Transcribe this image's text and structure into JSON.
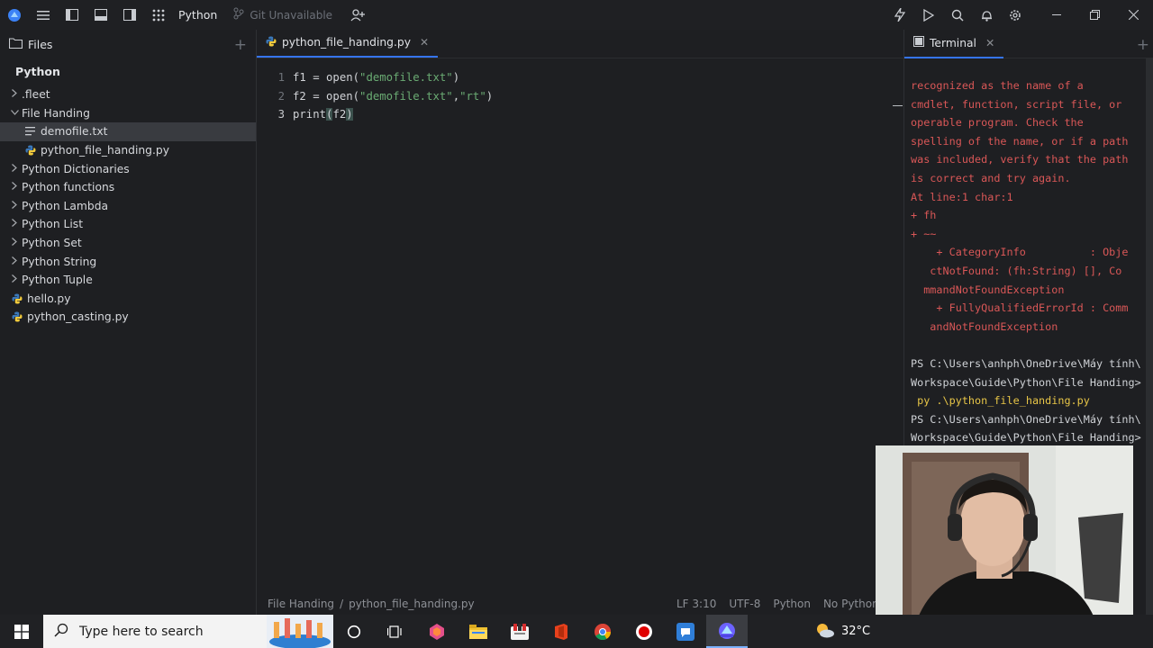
{
  "topbar": {
    "project": "Python",
    "git": "Git Unavailable"
  },
  "files_panel": {
    "tab_label": "Files",
    "root": "Python",
    "items": [
      {
        "label": ".fleet",
        "kind": "folder",
        "depth": 0,
        "expanded": false
      },
      {
        "label": "File Handing",
        "kind": "folder",
        "depth": 0,
        "expanded": true
      },
      {
        "label": "demofile.txt",
        "kind": "text-file",
        "depth": 1,
        "selected": true
      },
      {
        "label": "python_file_handing.py",
        "kind": "python-file",
        "depth": 1
      },
      {
        "label": "Python Dictionaries",
        "kind": "folder",
        "depth": 0,
        "expanded": false
      },
      {
        "label": "Python functions",
        "kind": "folder",
        "depth": 0,
        "expanded": false
      },
      {
        "label": "Python Lambda",
        "kind": "folder",
        "depth": 0,
        "expanded": false
      },
      {
        "label": "Python List",
        "kind": "folder",
        "depth": 0,
        "expanded": false
      },
      {
        "label": "Python Set",
        "kind": "folder",
        "depth": 0,
        "expanded": false
      },
      {
        "label": "Python String",
        "kind": "folder",
        "depth": 0,
        "expanded": false
      },
      {
        "label": "Python Tuple",
        "kind": "folder",
        "depth": 0,
        "expanded": false
      },
      {
        "label": "hello.py",
        "kind": "python-file",
        "depth": 0
      },
      {
        "label": "python_casting.py",
        "kind": "python-file",
        "depth": 0
      }
    ]
  },
  "editor": {
    "tab_label": "python_file_handing.py",
    "lines": [
      {
        "num": "1",
        "pre": "f1 = open(",
        "str": "\"demofile.txt\"",
        "post": ")"
      },
      {
        "num": "2",
        "pre": "f2 = open(",
        "str": "\"demofile.txt\"",
        "mid": ",",
        "str2": "\"rt\"",
        "post": ")"
      },
      {
        "num": "3",
        "pre": "print",
        "paren_open": "(",
        "arg": "f2",
        "paren_close": ")"
      }
    ]
  },
  "statusbar": {
    "crumb_1": "File Handing",
    "crumb_sep": "/",
    "crumb_2": "python_file_handing.py",
    "position": "LF 3:10",
    "encoding": "UTF-8",
    "language": "Python",
    "interpreter": "No Python S"
  },
  "terminal": {
    "tab_label": "Terminal",
    "lines": [
      {
        "text": "recognized as the name of a",
        "style": "err"
      },
      {
        "text": "cmdlet, function, script file, or",
        "style": "err"
      },
      {
        "text": "operable program. Check the",
        "style": "err"
      },
      {
        "text": "spelling of the name, or if a path",
        "style": "err"
      },
      {
        "text": "was included, verify that the path",
        "style": "err"
      },
      {
        "text": "is correct and try again.",
        "style": "err"
      },
      {
        "text": "At line:1 char:1",
        "style": "err"
      },
      {
        "text": "+ fh",
        "style": "err"
      },
      {
        "text": "+ ~~",
        "style": "err"
      },
      {
        "text": "    + CategoryInfo          : Obje",
        "style": "err"
      },
      {
        "text": "   ctNotFound: (fh:String) [], Co",
        "style": "err"
      },
      {
        "text": "  mmandNotFoundException",
        "style": "err"
      },
      {
        "text": "    + FullyQualifiedErrorId : Comm",
        "style": "err"
      },
      {
        "text": "   andNotFoundException",
        "style": "err"
      },
      {
        "text": "",
        "style": "norm"
      },
      {
        "text": "PS C:\\Users\\anhph\\OneDrive\\Máy tính\\",
        "style": "norm"
      },
      {
        "text": "Workspace\\Guide\\Python\\File Handing>",
        "style": "norm"
      },
      {
        "text": " py .\\python_file_handing.py",
        "style": "cmd"
      },
      {
        "text": "PS C:\\Users\\anhph\\OneDrive\\Máy tính\\",
        "style": "norm"
      },
      {
        "text": "Workspace\\Guide\\Python\\File Handing>",
        "style": "norm"
      }
    ]
  },
  "taskbar": {
    "search_placeholder": "Type here to search",
    "temperature": "32°C"
  },
  "colors": {
    "accent": "#3574f0",
    "error_text": "#d95757",
    "string": "#6aab73",
    "command": "#e7c547"
  }
}
